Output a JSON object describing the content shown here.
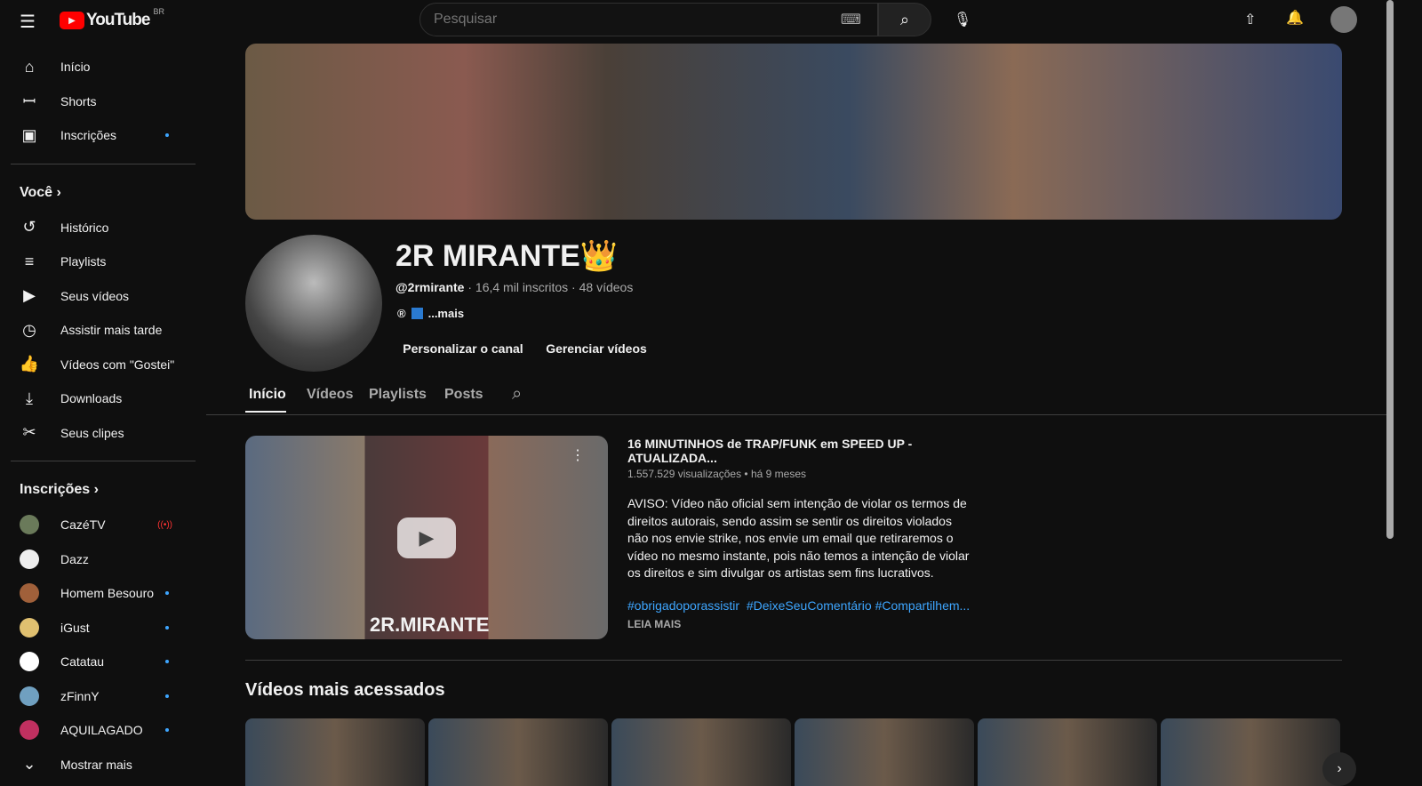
{
  "header": {
    "logo": "YouTube",
    "country": "BR",
    "search_placeholder": "Pesquisar"
  },
  "sidebar": {
    "main": [
      {
        "label": "Início",
        "icon": "home-icon"
      },
      {
        "label": "Shorts",
        "icon": "shorts-icon"
      },
      {
        "label": "Inscrições",
        "icon": "subscriptions-icon",
        "dot": true
      }
    ],
    "you_title": "Você",
    "you": [
      {
        "label": "Histórico",
        "icon": "history-icon"
      },
      {
        "label": "Playlists",
        "icon": "playlists-icon"
      },
      {
        "label": "Seus vídeos",
        "icon": "your-videos-icon"
      },
      {
        "label": "Assistir mais tarde",
        "icon": "watch-later-icon"
      },
      {
        "label": "Vídeos com \"Gostei\"",
        "icon": "like-icon"
      },
      {
        "label": "Downloads",
        "icon": "download-icon"
      },
      {
        "label": "Seus clipes",
        "icon": "clips-icon"
      }
    ],
    "subs_title": "Inscrições",
    "subs": [
      {
        "label": "CazéTV",
        "live": true,
        "color": "#6a7a5a"
      },
      {
        "label": "Dazz",
        "color": "#eeeeee"
      },
      {
        "label": "Homem Besouro",
        "color": "#a0603a",
        "dot": true
      },
      {
        "label": "iGust",
        "color": "#e0c070",
        "dot": true
      },
      {
        "label": "Catatau",
        "color": "#ffffff",
        "dot": true
      },
      {
        "label": "zFinnY",
        "color": "#70a0c0",
        "dot": true
      },
      {
        "label": "AQUILAGADO",
        "color": "#c03060",
        "dot": true
      }
    ],
    "show_more": "Mostrar mais"
  },
  "channel": {
    "name": "2R MIRANTE👑",
    "handle": "@2rmirante",
    "stats": " · 16,4 mil inscritos · 48 vídeos",
    "more": "...mais",
    "customize": "Personalizar o canal",
    "manage": "Gerenciar vídeos"
  },
  "tabs": [
    "Início",
    "Vídeos",
    "Playlists",
    "Posts"
  ],
  "featured": {
    "title": "16 MINUTINHOS de TRAP/FUNK em SPEED UP - ATUALIZADA...",
    "meta": "1.557.529 visualizações • há 9 meses",
    "description": "AVISO: Vídeo não oficial sem intenção de violar os termos de direitos autorais, sendo assim se sentir os direitos violados não nos envie strike, nos envie um email que retiraremos o vídeo no mesmo instante, pois não temos a intenção de violar os direitos e sim divulgar os artistas sem fins lucrativos.",
    "hashtags": "#obrigadoporassistir  #DeixeSeuComentário #Compartilhem...",
    "read_more": "LEIA MAIS",
    "thumb_text": "2R.MIRANTE"
  },
  "section_title": "Vídeos mais acessados"
}
